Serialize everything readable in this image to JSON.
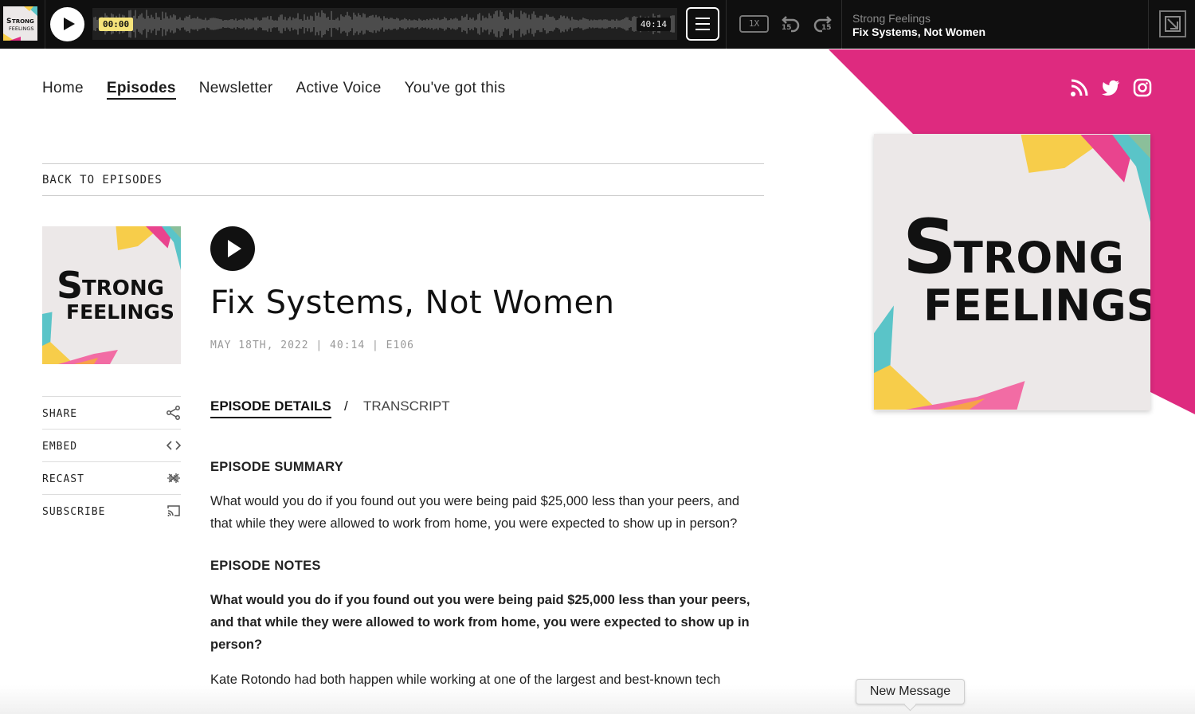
{
  "player": {
    "current_time": "00:00",
    "duration": "40:14",
    "speed": "1X",
    "skip_back": "15",
    "skip_forward": "15",
    "show_name": "Strong Feelings",
    "episode_title": "Fix Systems, Not Women",
    "progress": 0
  },
  "nav": {
    "items": [
      {
        "label": "Home"
      },
      {
        "label": "Episodes"
      },
      {
        "label": "Newsletter"
      },
      {
        "label": "Active Voice"
      },
      {
        "label": "You've got this"
      }
    ],
    "active": "Episodes"
  },
  "social": [
    "rss-icon",
    "twitter-icon",
    "instagram-icon"
  ],
  "back_link": "BACK TO EPISODES",
  "episode": {
    "title": "Fix Systems, Not Women",
    "meta": "MAY 18TH, 2022 | 40:14 | E106",
    "tabs": {
      "details": "EPISODE DETAILS",
      "separator": "/",
      "transcript": "TRANSCRIPT"
    },
    "summary_heading": "EPISODE SUMMARY",
    "summary": "What would you do if you found out you were being paid $25,000 less than your peers, and that while they were allowed to work from home, you were expected to show up in person?",
    "notes_heading": "EPISODE NOTES",
    "notes_bold": "What would you do if you found out you were being paid $25,000 less than your peers, and that while they were allowed to work from home, you were expected to show up in person?",
    "notes_text": "Kate Rotondo had both happen while working at one of the largest and best-known tech"
  },
  "actions": [
    {
      "label": "SHARE",
      "icon": "share-icon"
    },
    {
      "label": "EMBED",
      "icon": "code-icon"
    },
    {
      "label": "RECAST",
      "icon": "recast-icon"
    },
    {
      "label": "SUBSCRIBE",
      "icon": "cast-icon"
    }
  ],
  "cover_art": {
    "line1": "STRONG",
    "line2": "FEELINGS"
  },
  "new_message": "New Message",
  "colors": {
    "pink": "#de2a7f",
    "yellow": "#f7cd4a",
    "teal": "#5ac4c8",
    "dark": "#0f0f0f"
  }
}
